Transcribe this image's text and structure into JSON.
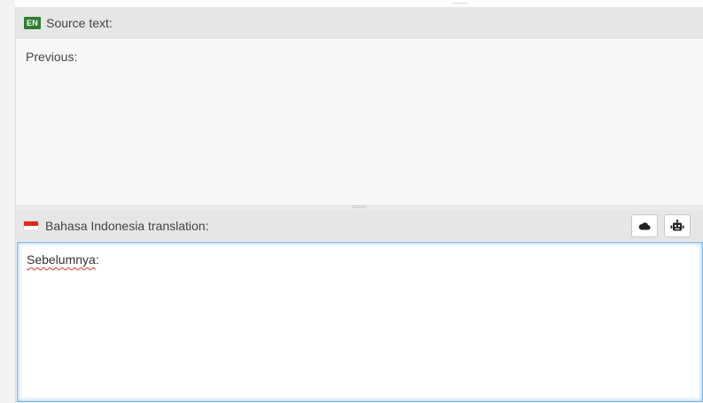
{
  "source": {
    "lang_code": "EN",
    "header_label": "Source text:",
    "text": "Previous:"
  },
  "translation": {
    "header_label": "Bahasa Indonesia translation:",
    "text_word": "Sebelumnya",
    "text_punct": ":",
    "actions": [
      {
        "icon": "cloud-icon"
      },
      {
        "icon": "robot-icon"
      }
    ]
  },
  "colors": {
    "lang_badge": "#2e7d32",
    "focus_border": "#7fb8e6",
    "flag_red": "#e0271f",
    "spellcheck": "#d9342b"
  }
}
